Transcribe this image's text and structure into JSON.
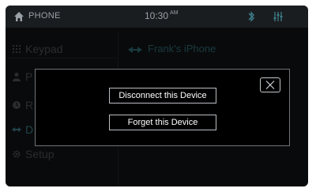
{
  "statusbar": {
    "title": "PHONE",
    "time": "10:30",
    "ampm": "AM"
  },
  "sidebar": {
    "items": [
      {
        "label": "Keypad",
        "icon": "keypad-icon"
      },
      {
        "label": "P",
        "icon": "person-icon"
      },
      {
        "label": "R",
        "icon": "recent-icon"
      },
      {
        "label": "D",
        "icon": "device-icon",
        "active": true
      },
      {
        "label": "Setup",
        "icon": "gear-icon"
      }
    ]
  },
  "device": {
    "name": "Frank's iPhone",
    "icon": "device-link-icon"
  },
  "modal": {
    "disconnect_label": "Disconnect this Device",
    "forget_label": "Forget this Device",
    "close_icon": "close-icon"
  },
  "colors": {
    "accent": "#3d7d8a",
    "background": "#111315",
    "modal_border": "#6e7478"
  }
}
